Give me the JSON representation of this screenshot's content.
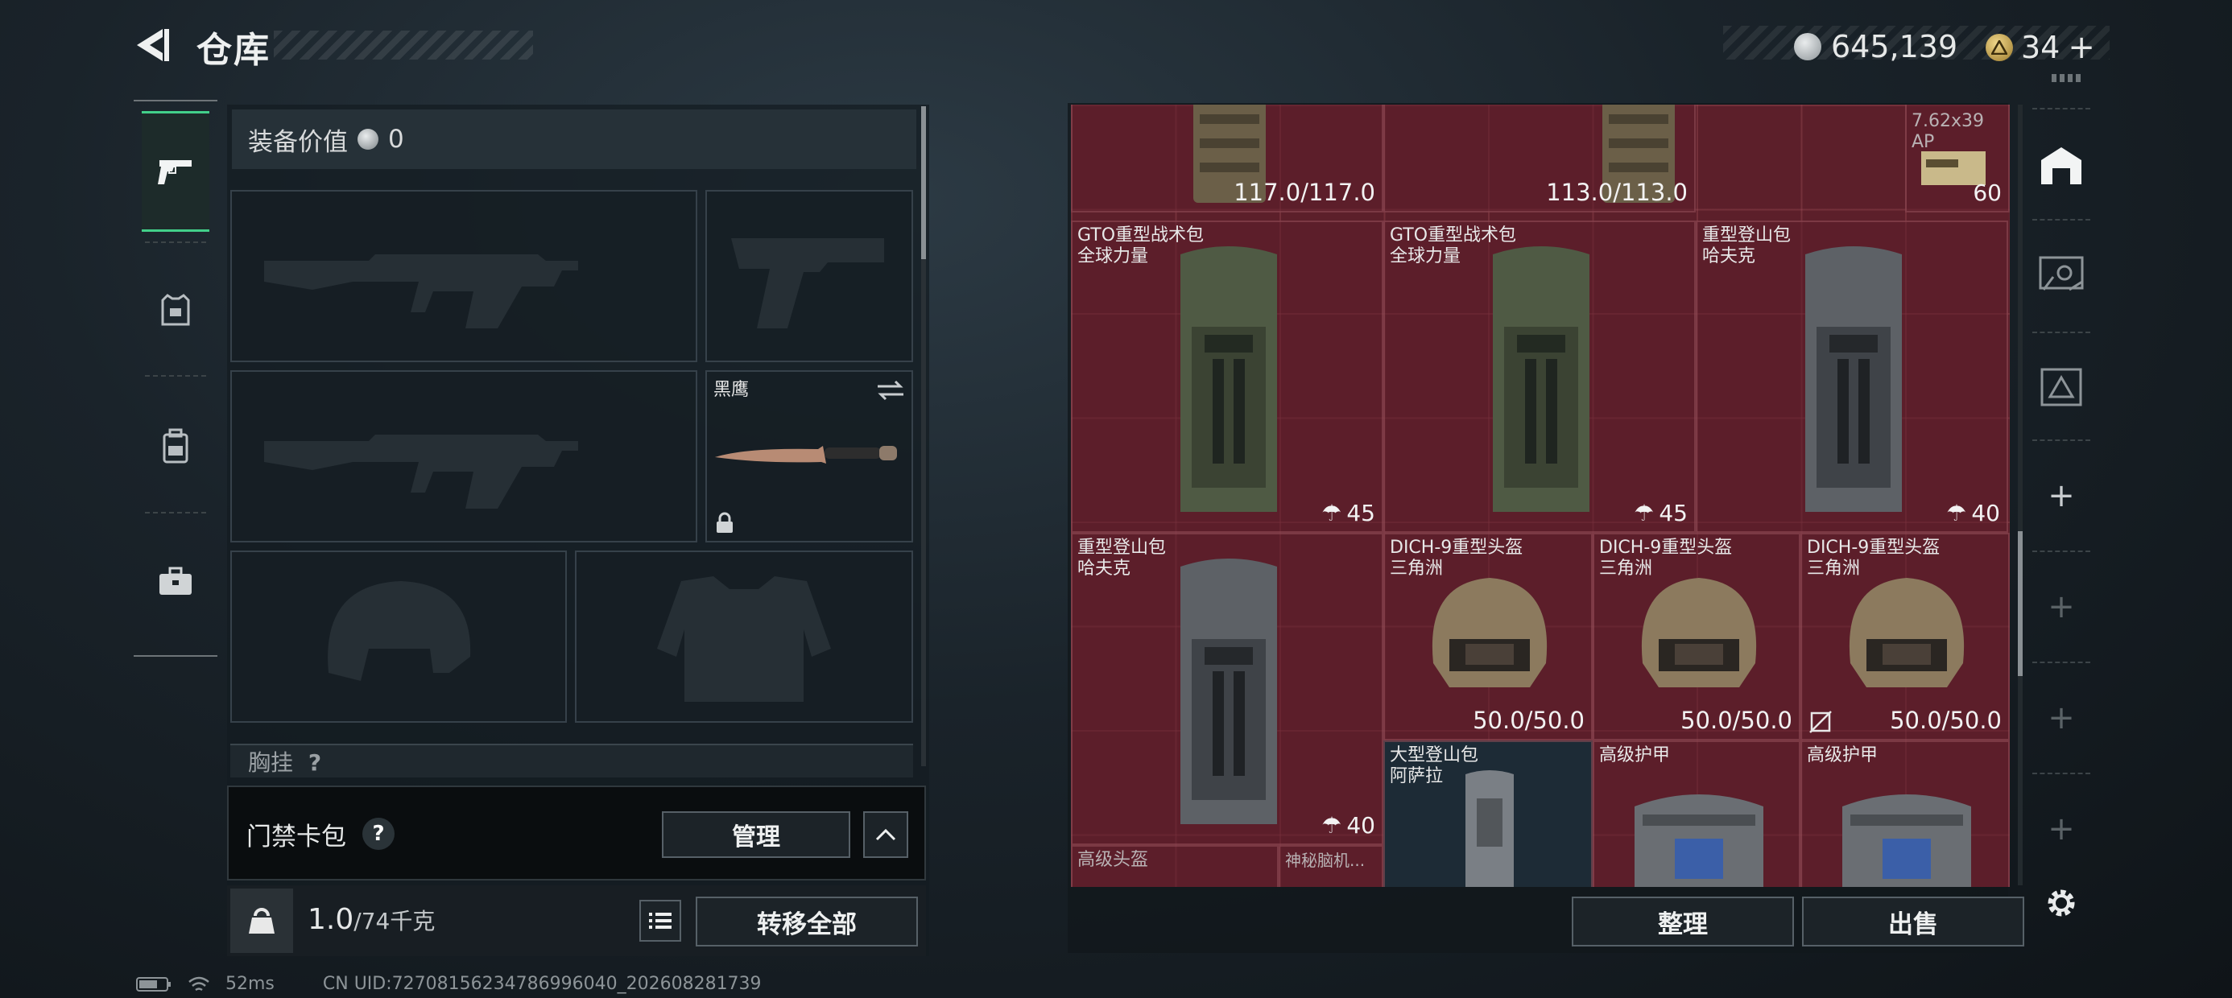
{
  "header": {
    "title": "仓库",
    "currency": [
      {
        "icon": "silver-coin-icon",
        "value": "645,139"
      },
      {
        "icon": "gold-triangle-coin-icon",
        "value": "34"
      }
    ],
    "add_label": "+"
  },
  "left_rail": {
    "tabs": [
      {
        "icon": "pistol-icon",
        "active": true
      },
      {
        "icon": "vest-icon",
        "active": false
      },
      {
        "icon": "backpack-icon",
        "active": false
      },
      {
        "icon": "briefcase-icon",
        "active": false
      }
    ]
  },
  "loadout": {
    "value_label": "装备价值",
    "value": "0",
    "knife_name": "黑鹰",
    "chest_rig_label": "胸挂",
    "chest_rig_help": "?",
    "keycard_label": "门禁卡包",
    "keycard_help": "?",
    "manage_label": "管理",
    "weight_current": "1.0",
    "weight_capacity": "/74千克",
    "transfer_all_label": "转移全部"
  },
  "storage": {
    "items": [
      {
        "name": "",
        "sub": "",
        "value": "117.0/117.0",
        "kind": "durability"
      },
      {
        "name": "",
        "sub": "",
        "value": "113.0/113.0",
        "kind": "durability"
      },
      {
        "name": "7.62x39",
        "sub": "AP",
        "value": "60",
        "kind": "count"
      },
      {
        "name": "GTO重型战术包",
        "sub": "全球力量",
        "value": "45",
        "kind": "capacity"
      },
      {
        "name": "GTO重型战术包",
        "sub": "全球力量",
        "value": "45",
        "kind": "capacity"
      },
      {
        "name": "重型登山包",
        "sub": "哈夫克",
        "value": "40",
        "kind": "capacity"
      },
      {
        "name": "重型登山包",
        "sub": "哈夫克",
        "value": "40",
        "kind": "capacity"
      },
      {
        "name": "DICH-9重型头盔",
        "sub": "三角洲",
        "value": "50.0/50.0",
        "kind": "durability"
      },
      {
        "name": "DICH-9重型头盔",
        "sub": "三角洲",
        "value": "50.0/50.0",
        "kind": "durability"
      },
      {
        "name": "DICH-9重型头盔",
        "sub": "三角洲",
        "value": "50.0/50.0",
        "kind": "durability"
      },
      {
        "name": "大型登山包",
        "sub": "阿萨拉",
        "value": "",
        "kind": "none"
      },
      {
        "name": "高级护甲",
        "sub": "",
        "value": "",
        "kind": "none"
      },
      {
        "name": "高级护甲",
        "sub": "",
        "value": "",
        "kind": "none"
      },
      {
        "name": "高级头盔",
        "sub": "",
        "value": "",
        "kind": "none"
      },
      {
        "name": "神秘脑机...",
        "sub": "",
        "value": "",
        "kind": "none"
      }
    ],
    "sort_label": "整理",
    "sell_label": "出售"
  },
  "right_rail": {
    "items": [
      {
        "icon": "warehouse-icon",
        "label": ""
      },
      {
        "icon": "safe-box-icon",
        "label": ""
      },
      {
        "icon": "delta-vault-icon",
        "label": ""
      },
      {
        "icon": "add-tab-icon",
        "label": "+"
      },
      {
        "icon": "add-tab-icon",
        "label": "+"
      },
      {
        "icon": "add-tab-icon",
        "label": "+"
      },
      {
        "icon": "add-tab-icon",
        "label": "+"
      }
    ],
    "settings_icon": "gear-icon"
  },
  "status_bar": {
    "ping": "52ms",
    "uid": "CN UID:72708156234786996040_202608281739"
  },
  "colors": {
    "grid_bg": "#5c1f2a",
    "active_tab": "#42d08a",
    "panel_bg": "#141c21"
  }
}
